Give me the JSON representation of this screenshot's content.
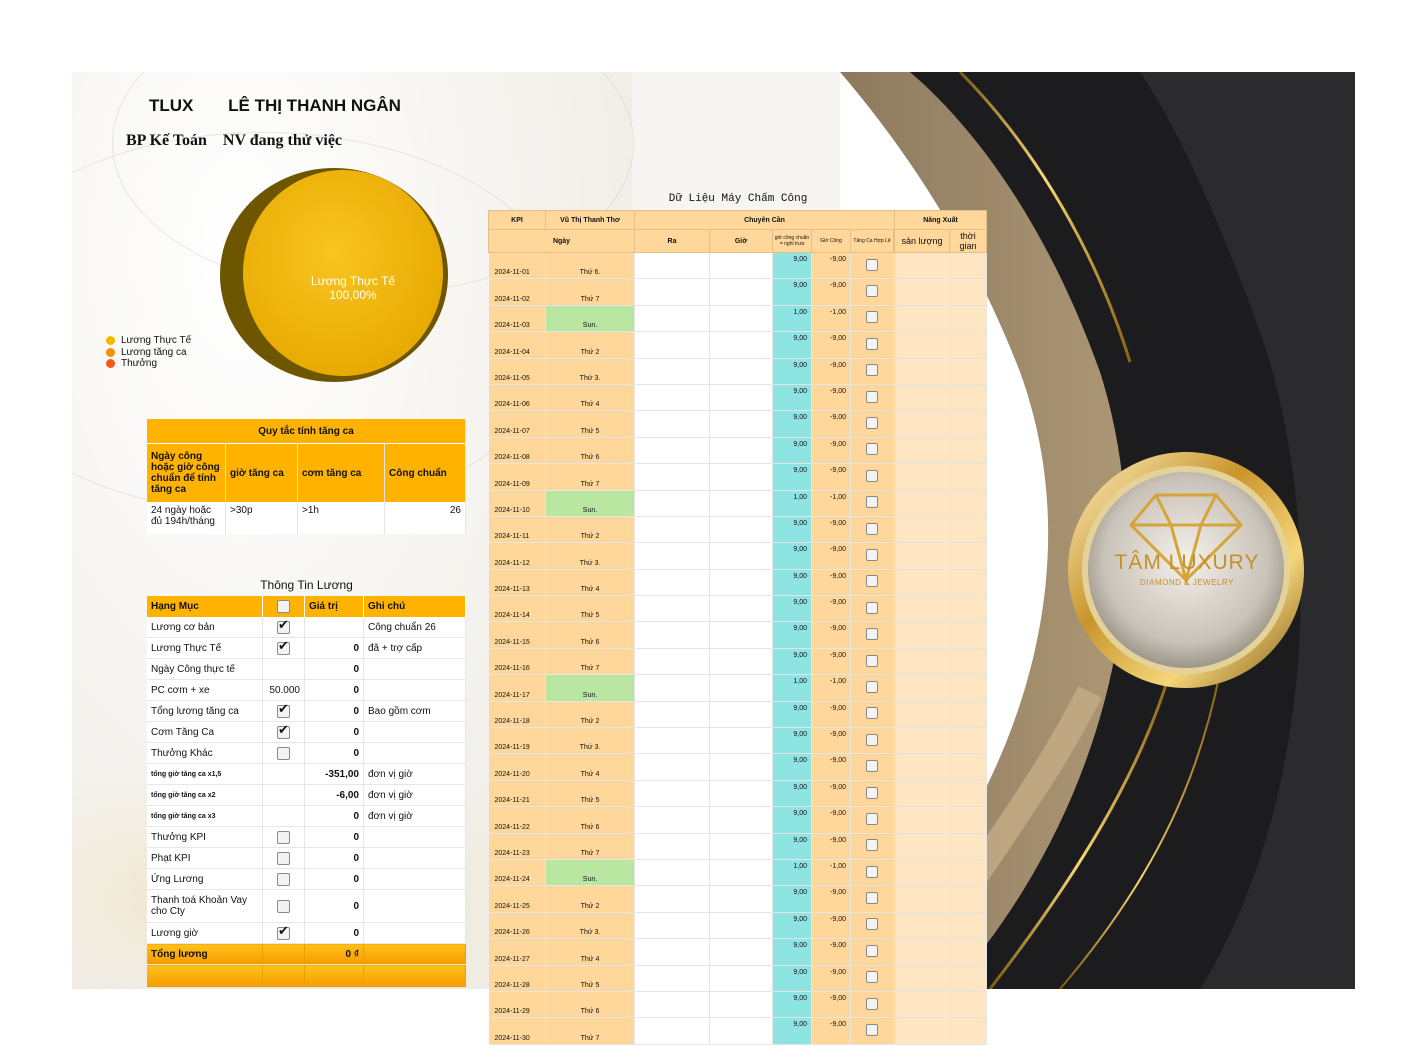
{
  "header": {
    "company": "TLUX",
    "employee": "LÊ THỊ THANH NGÂN",
    "dept": "BP Kế Toán",
    "status": "NV đang thử việc"
  },
  "pie": {
    "label": "Lương Thực Tế",
    "percent": "100,00%",
    "legend": [
      "Lương Thực Tế",
      "Lương tăng ca",
      "Thưởng"
    ],
    "colors": [
      "#f5b800",
      "#f39200",
      "#ef5a14"
    ]
  },
  "chart_data": {
    "type": "pie",
    "categories": [
      "Lương Thực Tế",
      "Lương tăng ca",
      "Thưởng"
    ],
    "values": [
      100,
      0,
      0
    ]
  },
  "rules": {
    "title": "Quy tắc tính tăng ca",
    "headers": [
      "Ngày công hoặc giờ công chuẩn để tính tăng ca",
      "giờ tăng ca",
      "cơm tăng ca",
      "Công chuẩn"
    ],
    "row": [
      "24 ngày hoặc đủ 194h/tháng",
      ">30p",
      ">1h",
      "26"
    ]
  },
  "salary": {
    "title": "Thông Tin Lương",
    "headers": [
      "Hạng Mục",
      "",
      "Giá trị",
      "Ghi chú"
    ],
    "rows": [
      {
        "name": "Lương cơ bản",
        "amt": "",
        "check": true,
        "val": "",
        "note": "Công chuẩn 26"
      },
      {
        "name": "Lương Thực Tế",
        "amt": "",
        "check": true,
        "val": "0",
        "note": "đã + trợ cấp"
      },
      {
        "name": "Ngày Công thực tế",
        "amt": "",
        "check": null,
        "val": "0",
        "note": ""
      },
      {
        "name": "PC cơm + xe",
        "amt": "50.000",
        "check": null,
        "val": "0",
        "note": ""
      },
      {
        "name": "Tổng lương tăng ca",
        "amt": "",
        "check": true,
        "val": "0",
        "note": "Bao gồm cơm"
      },
      {
        "name": "Cơm Tăng Ca",
        "amt": "",
        "check": true,
        "val": "0",
        "note": ""
      },
      {
        "name": "Thưởng Khác",
        "amt": "",
        "check": false,
        "val": "0",
        "note": ""
      },
      {
        "name": "tổng giờ tăng ca x1,5",
        "amt": "",
        "check": null,
        "val": "-351,00",
        "note": "đơn vị giờ",
        "tiny": true
      },
      {
        "name": "tổng giờ tăng ca x2",
        "amt": "",
        "check": null,
        "val": "-6,00",
        "note": "đơn vị giờ",
        "tiny": true
      },
      {
        "name": "tổng giờ tăng ca x3",
        "amt": "",
        "check": null,
        "val": "0",
        "note": "đơn vị giờ",
        "tiny": true
      },
      {
        "name": "Thưởng KPI",
        "amt": "",
        "check": false,
        "val": "0",
        "note": ""
      },
      {
        "name": "Phạt KPI",
        "amt": "",
        "check": false,
        "val": "0",
        "note": ""
      },
      {
        "name": "Ứng Lương",
        "amt": "",
        "check": false,
        "val": "0",
        "note": ""
      },
      {
        "name": "Thanh toá Khoản Vay cho Cty",
        "amt": "",
        "check": false,
        "val": "0",
        "note": "",
        "tall": true
      },
      {
        "name": "Lương giờ",
        "amt": "",
        "check": true,
        "val": "0",
        "note": ""
      }
    ],
    "total": {
      "label": "Tổng lương",
      "val": "0 ₫"
    }
  },
  "attendance": {
    "title": "Dữ Liệu Máy Chấm Công",
    "h_kpi": "KPI",
    "h_name": "Vũ Thị Thanh Thơ",
    "h_cc": "Chuyên Cần",
    "h_nx": "Năng Xuất",
    "h_ngay": "Ngày",
    "h_ra": "Ra",
    "h_gio": "Giờ",
    "h_gcc": "giờ công chuẩn = nghỉ trưa",
    "h_giocong": "Giờ Công",
    "h_tangca": "Tăng Ca Hợp Lệ",
    "h_sl": "sản lượng",
    "h_tg": "thời gian",
    "rows": [
      [
        "2024-11-01",
        "Thứ 6.",
        "9,00",
        "-9,00"
      ],
      [
        "2024-11-02",
        "Thứ 7",
        "9,00",
        "-9,00"
      ],
      [
        "2024-11-03",
        "Sun.",
        "1,00",
        "-1,00"
      ],
      [
        "2024-11-04",
        "Thứ 2",
        "9,00",
        "-9,00"
      ],
      [
        "2024-11-05",
        "Thứ 3.",
        "9,00",
        "-9,00"
      ],
      [
        "2024-11-06",
        "Thứ 4",
        "9,00",
        "-9,00"
      ],
      [
        "2024-11-07",
        "Thứ 5",
        "9,00",
        "-9,00"
      ],
      [
        "2024-11-08",
        "Thứ 6",
        "9,00",
        "-9,00"
      ],
      [
        "2024-11-09",
        "Thứ 7",
        "9,00",
        "-9,00"
      ],
      [
        "2024-11-10",
        "Sun.",
        "1,00",
        "-1,00"
      ],
      [
        "2024-11-11",
        "Thứ 2",
        "9,00",
        "-9,00"
      ],
      [
        "2024-11-12",
        "Thứ 3.",
        "9,00",
        "-9,00"
      ],
      [
        "2024-11-13",
        "Thứ 4",
        "9,00",
        "-9,00"
      ],
      [
        "2024-11-14",
        "Thứ 5",
        "9,00",
        "-9,00"
      ],
      [
        "2024-11-15",
        "Thứ 6",
        "9,00",
        "-9,00"
      ],
      [
        "2024-11-16",
        "Thứ 7",
        "9,00",
        "-9,00"
      ],
      [
        "2024-11-17",
        "Sun.",
        "1,00",
        "-1,00"
      ],
      [
        "2024-11-18",
        "Thứ 2",
        "9,00",
        "-9,00"
      ],
      [
        "2024-11-19",
        "Thứ 3.",
        "9,00",
        "-9,00"
      ],
      [
        "2024-11-20",
        "Thứ 4",
        "9,00",
        "-9,00"
      ],
      [
        "2024-11-21",
        "Thứ 5",
        "9,00",
        "-9,00"
      ],
      [
        "2024-11-22",
        "Thứ 6",
        "9,00",
        "-9,00"
      ],
      [
        "2024-11-23",
        "Thứ 7",
        "9,00",
        "-9,00"
      ],
      [
        "2024-11-24",
        "Sun.",
        "1,00",
        "-1,00"
      ],
      [
        "2024-11-25",
        "Thứ 2",
        "9,00",
        "-9,00"
      ],
      [
        "2024-11-26",
        "Thứ 3.",
        "9,00",
        "-9,00"
      ],
      [
        "2024-11-27",
        "Thứ 4",
        "9,00",
        "-9,00"
      ],
      [
        "2024-11-28",
        "Thứ 5",
        "9,00",
        "-9,00"
      ],
      [
        "2024-11-29",
        "Thứ 6",
        "9,00",
        "-9,00"
      ],
      [
        "2024-11-30",
        "Thứ 7",
        "9,00",
        "-9,00"
      ]
    ]
  },
  "brand": {
    "name": "TÂM LUXURY",
    "tagline": "DIAMOND & JEWELRY"
  }
}
